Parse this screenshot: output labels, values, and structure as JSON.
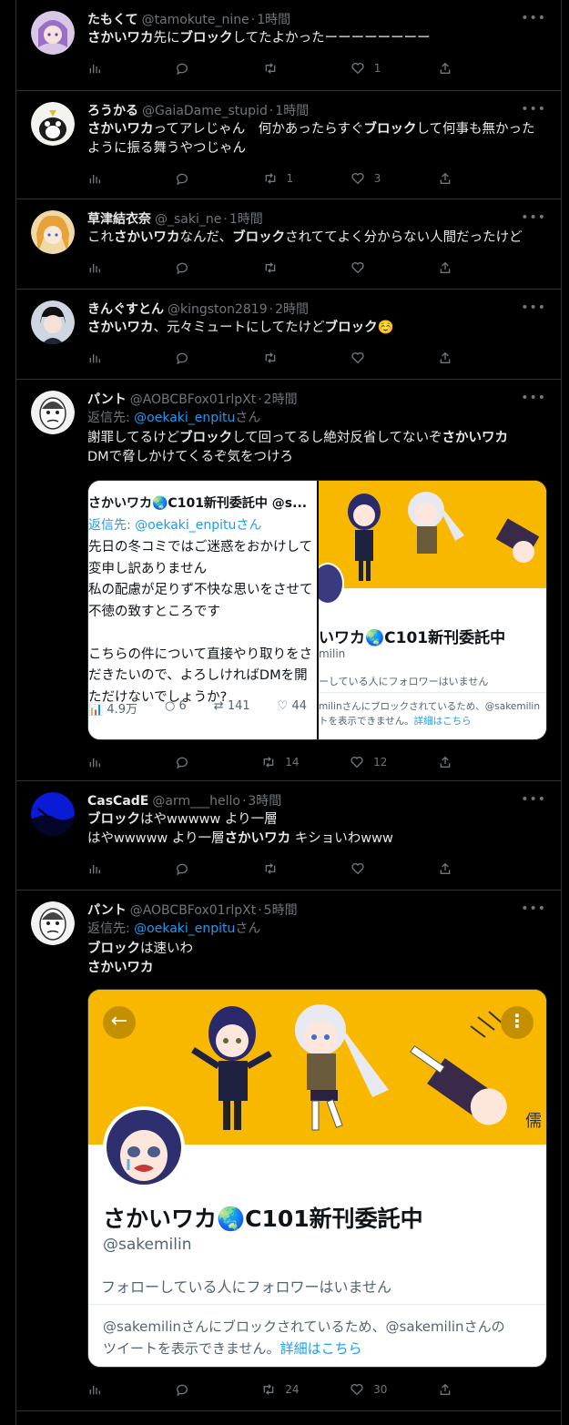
{
  "tweets": [
    {
      "name": "たもくて",
      "handle": "@tamokute_nine",
      "time": "1時間",
      "body_parts": [
        [
          "さかいワカ",
          true
        ],
        [
          "先に",
          false
        ],
        [
          "ブロック",
          true
        ],
        [
          "してたよかったーーーーーーーー",
          false
        ]
      ],
      "stats": {
        "views": "",
        "replies": "",
        "retweets": "",
        "likes": "1"
      }
    },
    {
      "name": "ろうかる",
      "handle": "@GaiaDame_stupid",
      "time": "1時間",
      "body_parts": [
        [
          "さかいワカ",
          true
        ],
        [
          "ってアレじゃん　何かあったらすぐ",
          false
        ],
        [
          "ブロック",
          true
        ],
        [
          "して何事も無かったように振る舞うやつじゃん",
          false
        ]
      ],
      "stats": {
        "views": "",
        "replies": "",
        "retweets": "1",
        "likes": "3"
      }
    },
    {
      "name": "草津結衣奈",
      "handle": "@_saki_ne",
      "time": "1時間",
      "body_parts": [
        [
          "これ",
          false
        ],
        [
          "さかいワカ",
          true
        ],
        [
          "なんだ、",
          false
        ],
        [
          "ブロック",
          true
        ],
        [
          "されててよく分からない人間だったけど",
          false
        ]
      ],
      "stats": {
        "views": "",
        "replies": "",
        "retweets": "",
        "likes": ""
      }
    },
    {
      "name": "きんぐすとん",
      "handle": "@kingston2819",
      "time": "2時間",
      "body_parts": [
        [
          "さかいワカ",
          true
        ],
        [
          "、元々ミュートにしてたけど",
          false
        ],
        [
          "ブロック",
          true
        ],
        [
          "☺️",
          false
        ]
      ],
      "stats": {
        "views": "",
        "replies": "",
        "retweets": "",
        "likes": ""
      }
    },
    {
      "name": "パント",
      "handle": "@AOBCBFox01rlpXt",
      "time": "2時間",
      "reply_prefix": "返信先: ",
      "reply_link": "@oekaki_enpitu",
      "reply_suffix": "さん",
      "body_parts": [
        [
          "謝罪してるけど",
          false
        ],
        [
          "ブロック",
          true
        ],
        [
          "して回ってるし絶対反省してないぞ",
          false
        ],
        [
          "さかいワカ",
          true
        ],
        [
          "\nDMで脅しかけてくるぞ気をつけろ",
          false
        ]
      ],
      "stats": {
        "views": "",
        "replies": "",
        "retweets": "14",
        "likes": "12"
      },
      "embed_left": {
        "header": "さかいワカ🌏C101新刊委託中 @s...",
        "reply": "返信先: @oekaki_enpituさん",
        "lines": [
          "先日の冬コミではご迷惑をおかけして",
          "変申し訳ありません",
          "私の配慮が足りず不快な思いをさせて",
          "不徳の致すところです",
          "",
          "こちらの件について直接やり取りをさ",
          "だきたいので、よろしければDMを開",
          "ただけないでしょうか?"
        ],
        "views": "4.9万",
        "replies": "6",
        "retweets": "141",
        "likes": "44"
      },
      "embed_right": {
        "name": "いワカ🌏C101新刊委託中",
        "handle": "milin",
        "notice": "ーしている人にフォロワーはいません",
        "blocked": "milinさんにブロックされているため、@sakemilin",
        "blocked2": "トを表示できません。",
        "link": "詳細はこちら"
      }
    },
    {
      "name": "CasCadE",
      "handle": "@arm___hello",
      "time": "3時間",
      "body_parts": [
        [
          "ブロック",
          true
        ],
        [
          "はやwwwww\nより一層",
          false
        ],
        [
          "さかいワカ",
          true
        ],
        [
          " キショいわwww",
          false
        ]
      ],
      "stats": {
        "views": "",
        "replies": "",
        "retweets": "",
        "likes": ""
      }
    },
    {
      "name": "パント",
      "handle": "@AOBCBFox01rlpXt",
      "time": "5時間",
      "reply_prefix": "返信先: ",
      "reply_link": "@oekaki_enpitu",
      "reply_suffix": "さん",
      "body_parts": [
        [
          "ブロック",
          true
        ],
        [
          "は速いわ\n",
          false
        ],
        [
          "さかいワカ",
          true
        ]
      ],
      "stats": {
        "views": "",
        "replies": "",
        "retweets": "24",
        "likes": "30"
      },
      "profile_card": {
        "name": "さかいワカ🌏C101新刊委託中",
        "handle": "@sakemilin",
        "notice": "フォローしている人にフォロワーはいません",
        "blocked_line1": "@sakemilinさんにブロックされているため、@sakemilinさんの",
        "blocked_line2": "ツイートを表示できません。",
        "link": "詳細はこちら"
      }
    }
  ],
  "icons": [
    "views-icon",
    "reply-icon",
    "retweet-icon",
    "like-icon",
    "share-icon",
    "more-icon",
    "back-arrow-icon"
  ],
  "colors": {
    "background": "#000000",
    "text": "#e7e9ea",
    "muted": "#71767b",
    "link": "#1d9bf0",
    "border": "#2f3336",
    "banner": "#f9b800"
  }
}
